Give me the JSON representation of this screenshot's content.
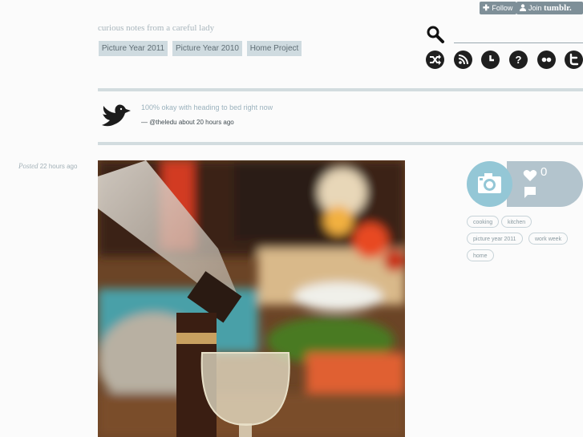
{
  "tumblr_controls": {
    "follow_label": "Follow",
    "join_label": "Join",
    "brand": "tumblr."
  },
  "blog": {
    "tagline": "curious notes from a careful lady"
  },
  "nav": {
    "items": [
      "Picture Year 2011",
      "Picture Year 2010",
      "Home Project"
    ]
  },
  "search": {
    "icon": "search-icon",
    "placeholder": ""
  },
  "social_icons": [
    "random-icon",
    "rss-icon",
    "archive-clock-icon",
    "ask-question-icon",
    "flickr-icon",
    "twitter-icon"
  ],
  "tweet": {
    "text": "100% okay with heading to bed right now",
    "meta": "— @theledu about 20 hours ago"
  },
  "post": {
    "posted_label": "Posted",
    "posted_time": "22 hours ago",
    "type_icon": "camera-icon",
    "note_count": "0",
    "tags": [
      "cooking",
      "kitchen",
      "picture year 2011",
      "work week",
      "home"
    ]
  },
  "colors": {
    "accent": "#94c7d6",
    "nav_bg": "#cfdbe0",
    "notes_bg": "#b3c4cd",
    "rule": "#d2dcdf"
  }
}
